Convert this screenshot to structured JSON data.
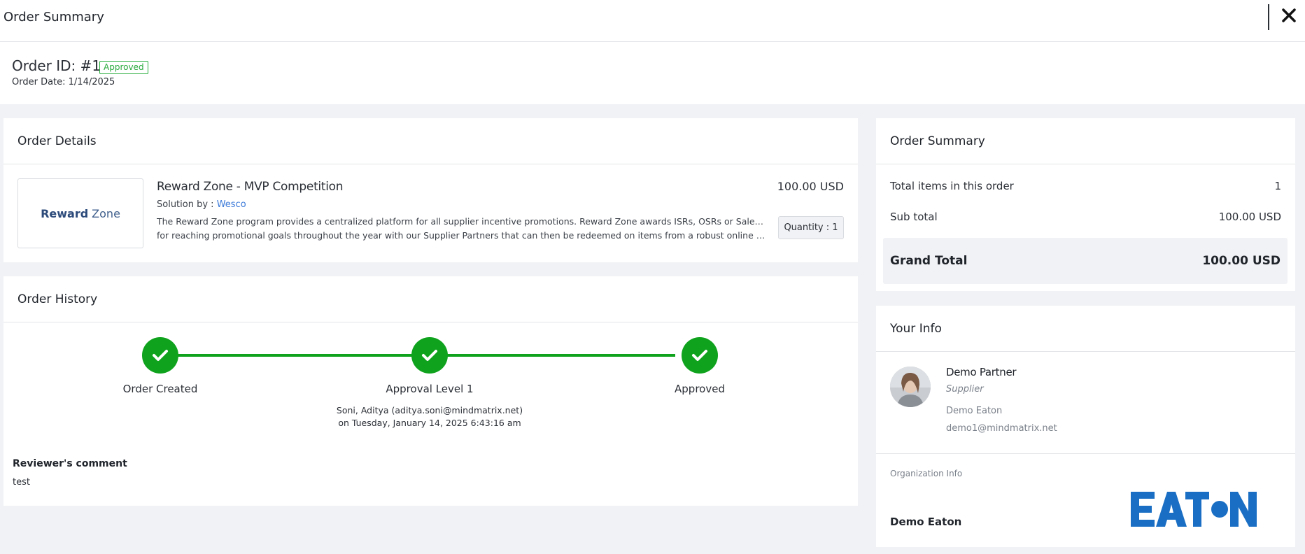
{
  "header": {
    "title": "Order Summary",
    "close_icon": "close-icon"
  },
  "order": {
    "id_label": "Order ID: #1",
    "status": "Approved",
    "date_label": "Order Date: 1/14/2025"
  },
  "details": {
    "title": "Order Details",
    "logo_bold": "Reward",
    "logo_light": "Zone",
    "product_name": "Reward Zone - MVP Competition",
    "solution_prefix": "Solution by : ",
    "solution_link": "Wesco",
    "description_line1": "The Reward Zone program provides a centralized platform for all supplier incentive promotions. Reward Zone awards ISRs, OSRs or Sales Managers",
    "description_line2": "for reaching promotional goals throughout the year with our Supplier Partners that can then be redeemed on items from a robust online merchandi...",
    "price": "100.00 USD",
    "quantity": "Quantity : 1"
  },
  "history": {
    "title": "Order History",
    "steps": [
      {
        "label": "Order Created"
      },
      {
        "label": "Approval Level 1",
        "sub1": "Soni, Aditya (aditya.soni@mindmatrix.net)",
        "sub2": "on Tuesday, January 14, 2025 6:43:16 am"
      },
      {
        "label": "Approved"
      }
    ],
    "reviewer_title": "Reviewer's comment",
    "reviewer_comment": "test"
  },
  "summary": {
    "title": "Order Summary",
    "items_label": "Total items in this order",
    "items_value": "1",
    "subtotal_label": "Sub total",
    "subtotal_value": "100.00 USD",
    "grand_label": "Grand Total",
    "grand_value": "100.00 USD"
  },
  "your_info": {
    "title": "Your Info",
    "name": "Demo Partner",
    "role": "Supplier",
    "org": "Demo Eaton",
    "email": "demo1@mindmatrix.net",
    "org_info_label": "Organization Info",
    "org_name": "Demo Eaton",
    "org_logo_text": "EATON"
  },
  "colors": {
    "accent_green": "#0fa31d",
    "link_blue": "#3d7bd9",
    "eaton_blue": "#1a6fc4"
  }
}
